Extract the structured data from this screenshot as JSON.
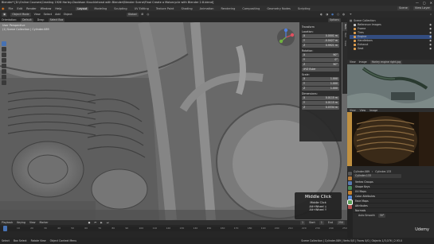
{
  "window": {
    "title": "Blender* [D:\\Online Courses\\Creating 1926 Harley-Davidson Knucklehead with Blender\\Blender Scene\\Final Create a Motorcycle with Blender 2.8.blend]",
    "controls": [
      "—",
      "▢",
      "✕"
    ]
  },
  "menubar": {
    "menus": [
      "File",
      "Edit",
      "Render",
      "Window",
      "Help"
    ],
    "workspaces": [
      "Layout",
      "Modeling",
      "Sculpting",
      "UV Editing",
      "Texture Paint",
      "Shading",
      "Animation",
      "Rendering",
      "Compositing",
      "Geometry Nodes",
      "Scripting"
    ],
    "active_workspace": "Layout",
    "scene": "Scene",
    "view_layer": "View Layer"
  },
  "viewport_header": {
    "mode": "Object Mode",
    "menus": [
      "View",
      "Select",
      "Add",
      "Object"
    ],
    "transform": "Global",
    "orientation_label": "Orientation:",
    "orientation": "Default",
    "drag_label": "Drag:",
    "drag": "Select Box",
    "options": "Options"
  },
  "viewport": {
    "view_name": "User Perspective",
    "object_info": "(1) Scene Collection | Cylinder.089"
  },
  "npanel": {
    "section": "Transform",
    "location_label": "Location:",
    "location": [
      [
        "X",
        "0.0001 m"
      ],
      [
        "Y",
        "-0.0427 m"
      ],
      [
        "Z",
        "0.9921 m"
      ]
    ],
    "rotation_label": "Rotation:",
    "rotation": [
      [
        "X",
        "90°"
      ],
      [
        "Y",
        "0°"
      ],
      [
        "Z",
        "90°"
      ]
    ],
    "mode": "XYZ Euler",
    "scale_label": "Scale:",
    "scale": [
      [
        "X",
        "1.000"
      ],
      [
        "Y",
        "1.000"
      ],
      [
        "Z",
        "1.000"
      ]
    ],
    "dimensions_label": "Dimensions:",
    "dimensions": [
      [
        "X",
        "0.0115 m"
      ],
      [
        "Y",
        "0.0115 m"
      ],
      [
        "Z",
        "0.0334 m"
      ]
    ],
    "tabs": [
      "Item",
      "Tool",
      "View"
    ]
  },
  "middle_click": {
    "title": "Middle Click",
    "lines": [
      "Middle Click",
      "Alt+Wheel ↓",
      "Alt+Wheel ↑"
    ]
  },
  "timeline": {
    "menus": [
      "Playback",
      "Keying",
      "View",
      "Marker"
    ],
    "frames": [
      "0",
      "10",
      "20",
      "30",
      "40",
      "50",
      "60",
      "70",
      "80",
      "90",
      "100",
      "110",
      "120",
      "130",
      "140",
      "150",
      "160",
      "170",
      "180",
      "190",
      "200",
      "210",
      "220",
      "230",
      "240",
      "250"
    ],
    "current_frame": "1",
    "start_label": "Start",
    "start": "1",
    "end_label": "End",
    "end": "250"
  },
  "statusbar": {
    "hints": [
      "Select",
      "Box Select",
      "Rotate View",
      "Object Context Menu"
    ],
    "stats": "Scene Collection | Cylinder.089 | Verts 0/0 | Faces 0/0 | Objects 1/3,076 | 2.93.0"
  },
  "outliner": {
    "title": "Scene Collection",
    "items": [
      {
        "label": "Reference Images",
        "color": "#c8c8c8",
        "selected": false
      },
      {
        "label": "Frame",
        "color": "#e0a050",
        "selected": false
      },
      {
        "label": "Tires",
        "color": "#e0a050",
        "selected": false
      },
      {
        "label": "Engine",
        "color": "#e0a050",
        "selected": true
      },
      {
        "label": "Handlebars",
        "color": "#e0a050",
        "selected": false
      },
      {
        "label": "Exhaust",
        "color": "#e0a050",
        "selected": false
      },
      {
        "label": "Seat",
        "color": "#e0a050",
        "selected": false
      }
    ]
  },
  "image_editor": {
    "menus": [
      "View",
      "Image"
    ],
    "image_name": "Harley engine right.jpg",
    "menus2": [
      "View",
      "View",
      "Image"
    ]
  },
  "properties": {
    "object_name": "Cylinder.089",
    "mesh_name": "Cylinder.133",
    "sections": [
      "Vertex Groups",
      "Shape Keys",
      "UV Maps",
      "Color Attributes",
      "Face Maps",
      "Attributes",
      "Normals"
    ],
    "autosmooth_label": "Auto Smooth",
    "autosmooth_value": "30°"
  },
  "watermark": "Udemy",
  "colors": {
    "accent": "#4772b3",
    "collection": "#e0a050",
    "viewport": "#6b6b6b"
  }
}
